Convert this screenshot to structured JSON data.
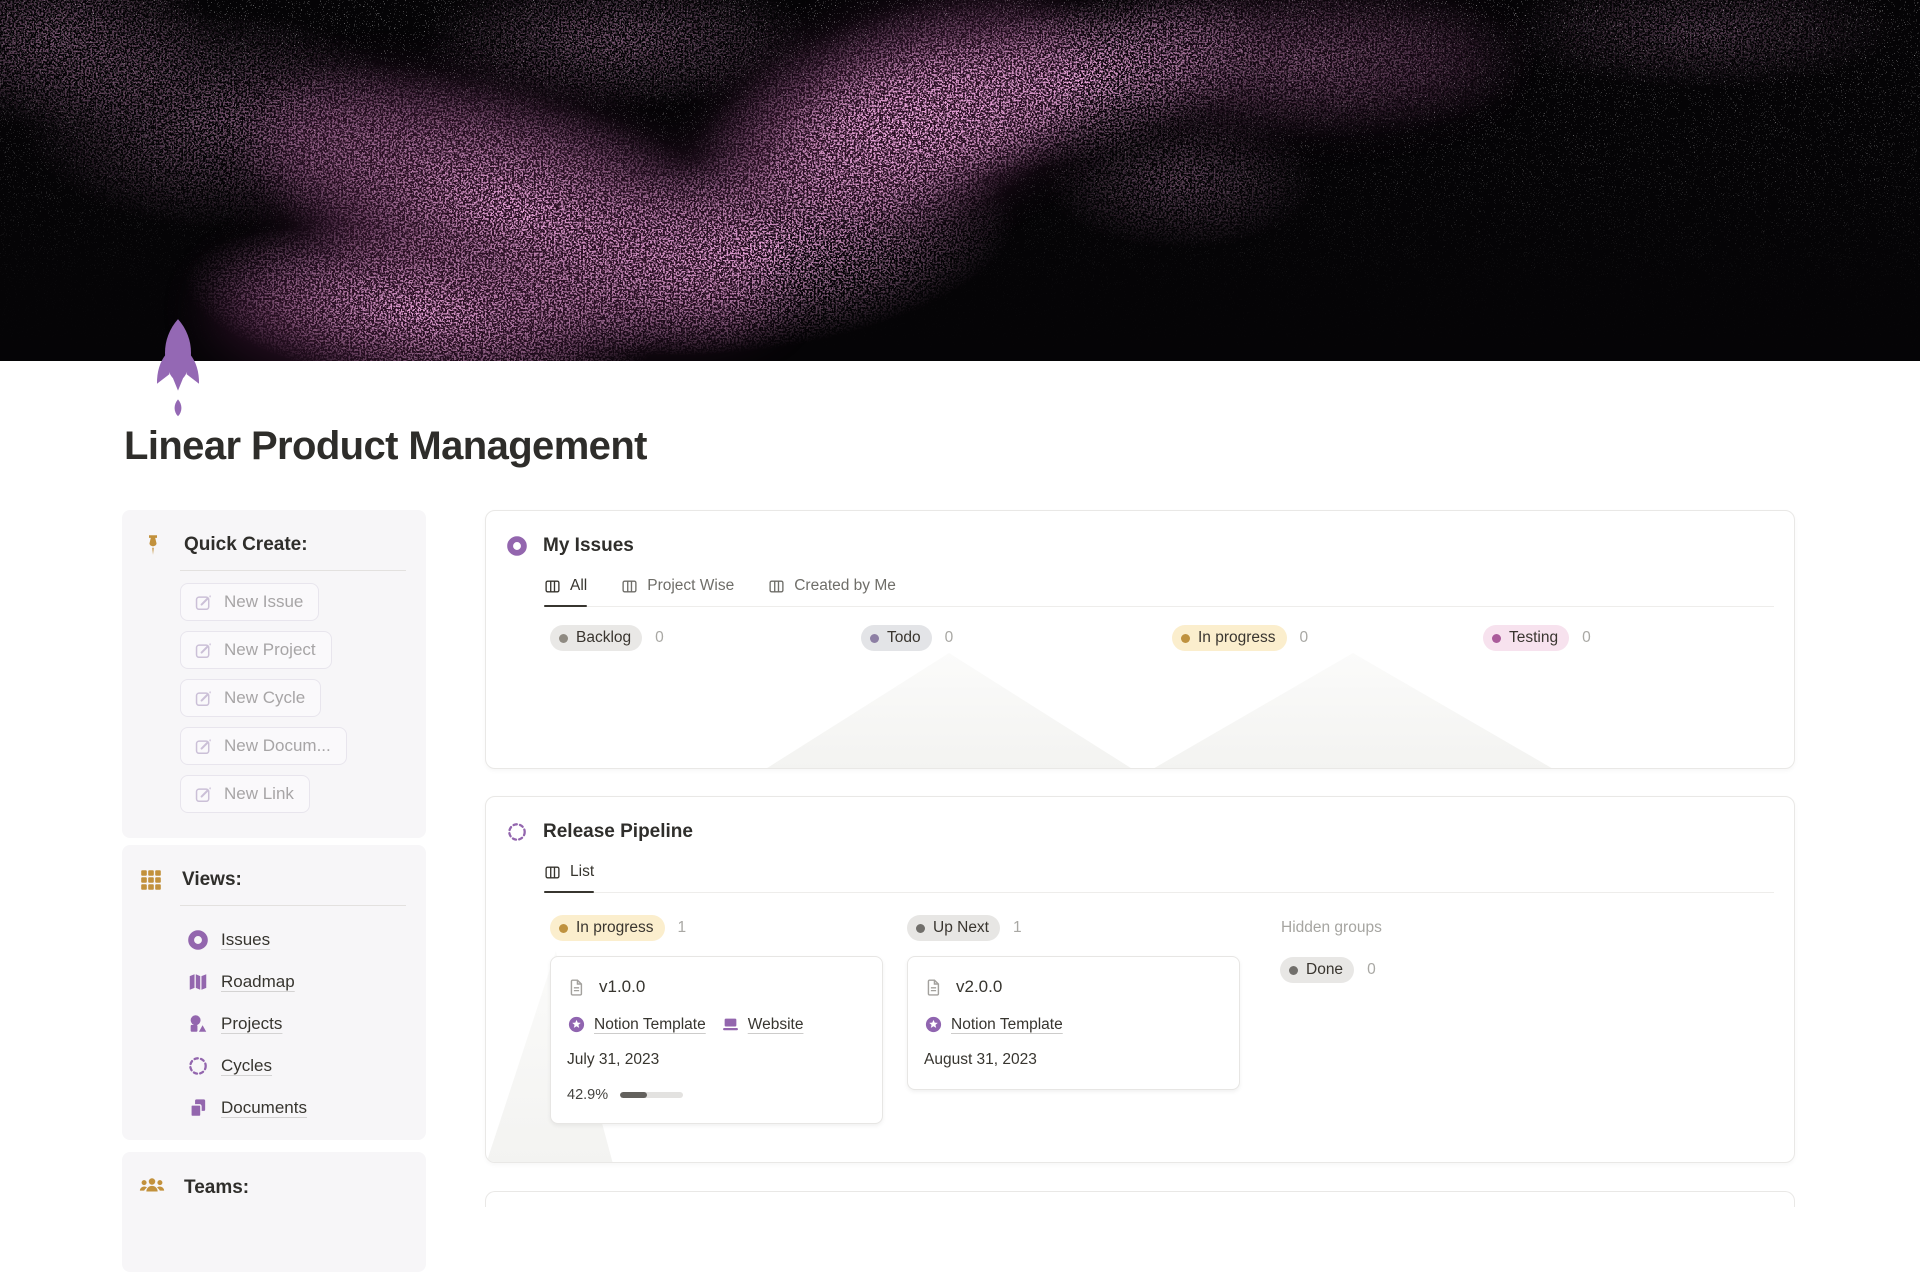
{
  "page": {
    "title": "Linear Product Management"
  },
  "sidebar": {
    "quick_create": {
      "heading": "Quick Create:",
      "buttons": [
        {
          "label": "New Issue",
          "icon": "compose-icon"
        },
        {
          "label": "New Project",
          "icon": "compose-icon"
        },
        {
          "label": "New Cycle",
          "icon": "compose-icon"
        },
        {
          "label": "New Docum...",
          "icon": "compose-icon"
        },
        {
          "label": "New Link",
          "icon": "compose-icon"
        }
      ]
    },
    "views": {
      "heading": "Views:",
      "items": [
        {
          "label": "Issues",
          "icon": "issue-donut-icon"
        },
        {
          "label": "Roadmap",
          "icon": "map-icon"
        },
        {
          "label": "Projects",
          "icon": "shapes-icon"
        },
        {
          "label": "Cycles",
          "icon": "dashed-circle-icon"
        },
        {
          "label": "Documents",
          "icon": "pages-icon"
        }
      ]
    },
    "teams": {
      "heading": "Teams:",
      "icon": "people-icon"
    }
  },
  "my_issues": {
    "title": "My Issues",
    "icon": "issue-donut-icon",
    "tabs": [
      {
        "label": "All",
        "active": true
      },
      {
        "label": "Project Wise",
        "active": false
      },
      {
        "label": "Created by Me",
        "active": false
      }
    ],
    "groups": [
      {
        "label": "Backlog",
        "count": "0",
        "pill_bg": "#e9e8e6",
        "dot_color": "#8f8a82"
      },
      {
        "label": "Todo",
        "count": "0",
        "pill_bg": "#e3e4e7",
        "dot_color": "#8d7fa4"
      },
      {
        "label": "In progress",
        "count": "0",
        "pill_bg": "#fbeecd",
        "dot_color": "#bf923f"
      },
      {
        "label": "Testing",
        "count": "0",
        "pill_bg": "#f7e2ee",
        "dot_color": "#aa5b9a"
      }
    ]
  },
  "release_pipeline": {
    "title": "Release Pipeline",
    "icon": "dashed-circle-icon",
    "tabs": [
      {
        "label": "List",
        "active": true
      }
    ],
    "groups": [
      {
        "label": "In progress",
        "count": "1",
        "pill_bg": "#fbeecd",
        "dot_color": "#bf923f"
      },
      {
        "label": "Up Next",
        "count": "1",
        "pill_bg": "#e7e6e4",
        "dot_color": "#716f6b"
      }
    ],
    "hidden_groups_label": "Hidden groups",
    "hidden_group": {
      "label": "Done",
      "count": "0",
      "pill_bg": "#e8e7e5",
      "dot_color": "#716f6b"
    },
    "cards": [
      {
        "title": "v1.0.0",
        "links": [
          {
            "label": "Notion Template",
            "icon": "notion-template-star-icon"
          },
          {
            "label": "Website",
            "icon": "laptop-icon"
          }
        ],
        "date": "July 31, 2023",
        "progress_label": "42.9%",
        "progress_pct": 42.9
      },
      {
        "title": "v2.0.0",
        "links": [
          {
            "label": "Notion Template",
            "icon": "notion-template-star-icon"
          }
        ],
        "date": "August 31, 2023"
      }
    ]
  },
  "colors": {
    "accent_purple": "#9065b0",
    "accent_gold": "#c2913c",
    "text": "#37352f",
    "muted": "#a9a8a4",
    "panel_bg": "#f7f6f8",
    "card_border": "#e9e8e6",
    "nebula_magenta": "#c043a0"
  }
}
